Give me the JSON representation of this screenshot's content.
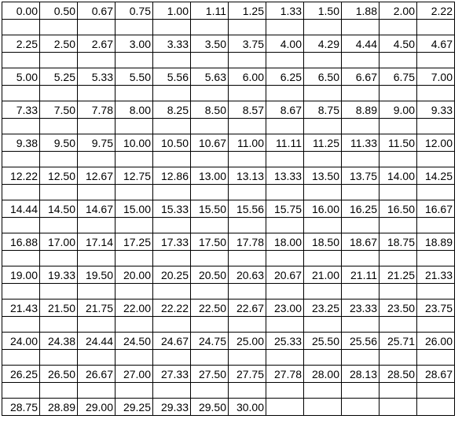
{
  "grid": {
    "columns": 12,
    "rows": [
      [
        "0.00",
        "0.50",
        "0.67",
        "0.75",
        "1.00",
        "1.11",
        "1.25",
        "1.33",
        "1.50",
        "1.88",
        "2.00",
        "2.22"
      ],
      [
        "2.25",
        "2.50",
        "2.67",
        "3.00",
        "3.33",
        "3.50",
        "3.75",
        "4.00",
        "4.29",
        "4.44",
        "4.50",
        "4.67"
      ],
      [
        "5.00",
        "5.25",
        "5.33",
        "5.50",
        "5.56",
        "5.63",
        "6.00",
        "6.25",
        "6.50",
        "6.67",
        "6.75",
        "7.00"
      ],
      [
        "7.33",
        "7.50",
        "7.78",
        "8.00",
        "8.25",
        "8.50",
        "8.57",
        "8.67",
        "8.75",
        "8.89",
        "9.00",
        "9.33"
      ],
      [
        "9.38",
        "9.50",
        "9.75",
        "10.00",
        "10.50",
        "10.67",
        "11.00",
        "11.11",
        "11.25",
        "11.33",
        "11.50",
        "12.00"
      ],
      [
        "12.22",
        "12.50",
        "12.67",
        "12.75",
        "12.86",
        "13.00",
        "13.13",
        "13.33",
        "13.50",
        "13.75",
        "14.00",
        "14.25"
      ],
      [
        "14.44",
        "14.50",
        "14.67",
        "15.00",
        "15.33",
        "15.50",
        "15.56",
        "15.75",
        "16.00",
        "16.25",
        "16.50",
        "16.67"
      ],
      [
        "16.88",
        "17.00",
        "17.14",
        "17.25",
        "17.33",
        "17.50",
        "17.78",
        "18.00",
        "18.50",
        "18.67",
        "18.75",
        "18.89"
      ],
      [
        "19.00",
        "19.33",
        "19.50",
        "20.00",
        "20.25",
        "20.50",
        "20.63",
        "20.67",
        "21.00",
        "21.11",
        "21.25",
        "21.33"
      ],
      [
        "21.43",
        "21.50",
        "21.75",
        "22.00",
        "22.22",
        "22.50",
        "22.67",
        "23.00",
        "23.25",
        "23.33",
        "23.50",
        "23.75"
      ],
      [
        "24.00",
        "24.38",
        "24.44",
        "24.50",
        "24.67",
        "24.75",
        "25.00",
        "25.33",
        "25.50",
        "25.56",
        "25.71",
        "26.00"
      ],
      [
        "26.25",
        "26.50",
        "26.67",
        "27.00",
        "27.33",
        "27.50",
        "27.75",
        "27.78",
        "28.00",
        "28.13",
        "28.50",
        "28.67"
      ],
      [
        "28.75",
        "28.89",
        "29.00",
        "29.25",
        "29.33",
        "29.50",
        "30.00",
        "",
        "",
        "",
        "",
        ""
      ]
    ]
  }
}
